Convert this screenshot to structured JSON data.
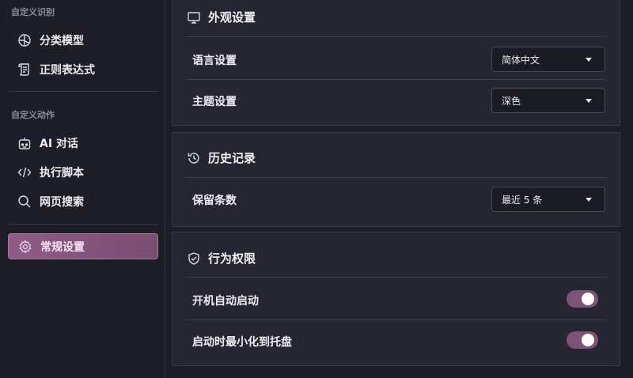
{
  "sidebar": {
    "section1": "自定义识别",
    "section2": "自定义动作",
    "items": [
      {
        "label": "分类模型",
        "icon": "globe-icon"
      },
      {
        "label": "正则表达式",
        "icon": "scroll-icon"
      },
      {
        "label": "AI 对话",
        "icon": "robot-icon"
      },
      {
        "label": "执行脚本",
        "icon": "code-icon"
      },
      {
        "label": "网页搜索",
        "icon": "search-icon"
      },
      {
        "label": "常规设置",
        "icon": "gear-icon",
        "active": true
      }
    ]
  },
  "appearance": {
    "title": "外观设置",
    "language_label": "语言设置",
    "language_value": "简体中文",
    "theme_label": "主题设置",
    "theme_value": "深色"
  },
  "history": {
    "title": "历史记录",
    "keep_label": "保留条数",
    "keep_value": "最近 5 条"
  },
  "behavior": {
    "title": "行为权限",
    "autostart_label": "开机自动启动",
    "autostart_on": true,
    "tray_label": "启动时最小化到托盘",
    "tray_on": true
  },
  "colors": {
    "accent": "#8f5b85",
    "toggle_on": "#7d5377",
    "background": "#1e1e28",
    "card": "#262633"
  }
}
